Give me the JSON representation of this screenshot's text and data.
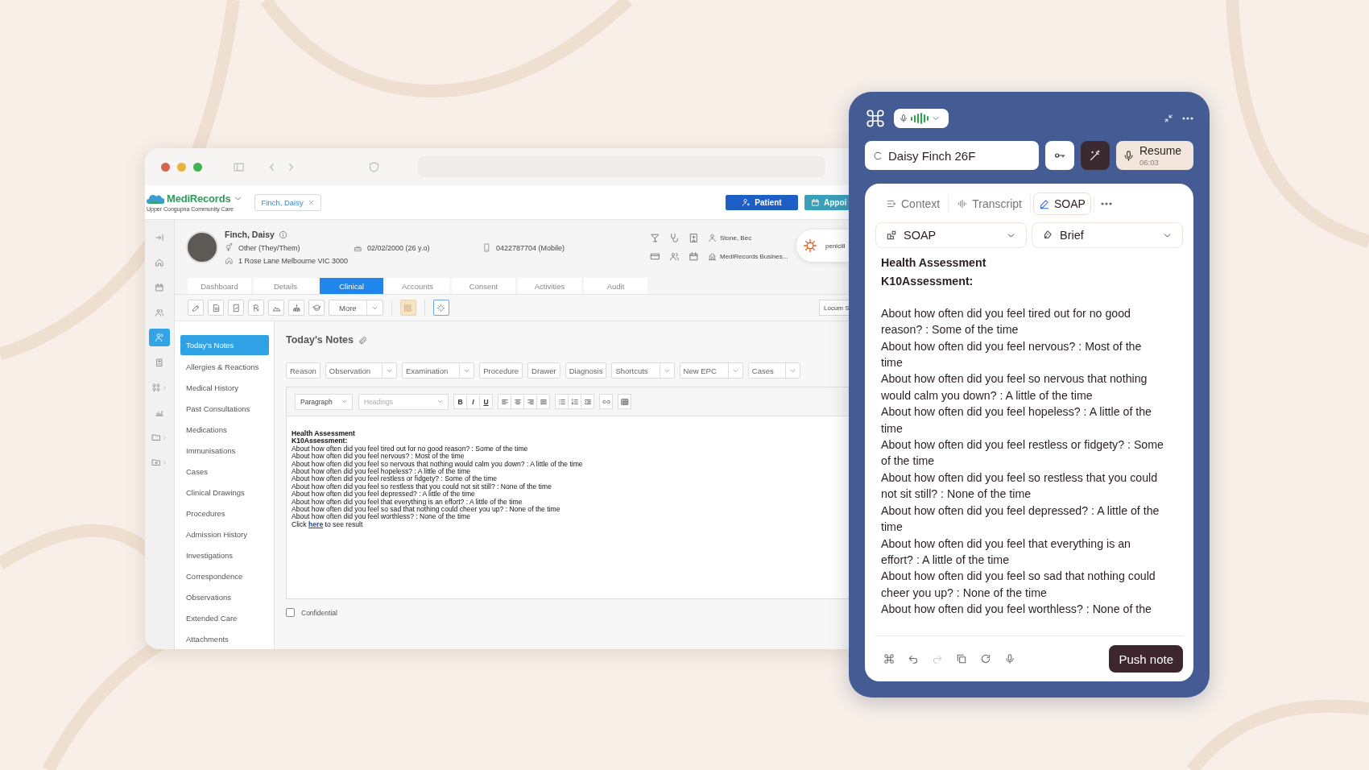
{
  "left_window": {
    "app": {
      "name": "MediRecords",
      "subtitle": "Upper Congupna Community Care"
    },
    "patient_chip": "Finch, Daisy",
    "header_buttons": [
      {
        "label": "Patient",
        "kind": "primary"
      },
      {
        "label": "Appoi",
        "kind": "secondary"
      }
    ],
    "rail": [
      {
        "kind": "collapse",
        "selected": false,
        "submenu": false
      },
      {
        "kind": "home",
        "selected": false,
        "submenu": false
      },
      {
        "kind": "calendar",
        "selected": false,
        "submenu": false
      },
      {
        "kind": "people",
        "selected": false,
        "submenu": false
      },
      {
        "kind": "patient",
        "selected": true,
        "submenu": false
      },
      {
        "kind": "clipboard",
        "selected": false,
        "submenu": false
      },
      {
        "kind": "apps",
        "selected": false,
        "submenu": true
      },
      {
        "kind": "chart",
        "selected": false,
        "submenu": false
      },
      {
        "kind": "folder",
        "selected": false,
        "submenu": true
      },
      {
        "kind": "folder-add",
        "selected": false,
        "submenu": true
      }
    ],
    "patient": {
      "name": "Finch, Daisy",
      "gender": "Other (They/Them)",
      "dob": "02/02/2000 (26 y.o)",
      "phone": "0422787704 (Mobile)",
      "address": "1 Rose Lane Melbourne VIC 3000",
      "practitioner": "Stone, Bec",
      "billing": "MediRecords Busines...",
      "allergy": "penicill"
    },
    "tabs": [
      {
        "label": "Dashboard",
        "selected": false
      },
      {
        "label": "Details",
        "selected": false
      },
      {
        "label": "Clinical",
        "selected": true
      },
      {
        "label": "Accounts",
        "selected": false
      },
      {
        "label": "Consent",
        "selected": false
      },
      {
        "label": "Activities",
        "selected": false
      },
      {
        "label": "Audit",
        "selected": false
      }
    ],
    "toolbar": {
      "more": "More",
      "right_field": "Locum S"
    },
    "nav": [
      {
        "label": "Today's Notes",
        "selected": true
      },
      {
        "label": "Allergies & Reactions",
        "selected": false
      },
      {
        "label": "Medical History",
        "selected": false
      },
      {
        "label": "Past Consultations",
        "selected": false
      },
      {
        "label": "Medications",
        "selected": false
      },
      {
        "label": "Immunisations",
        "selected": false
      },
      {
        "label": "Cases",
        "selected": false
      },
      {
        "label": "Clinical Drawings",
        "selected": false
      },
      {
        "label": "Procedures",
        "selected": false
      },
      {
        "label": "Admission History",
        "selected": false
      },
      {
        "label": "Investigations",
        "selected": false
      },
      {
        "label": "Correspondence",
        "selected": false
      },
      {
        "label": "Observations",
        "selected": false
      },
      {
        "label": "Extended Care",
        "selected": false
      },
      {
        "label": "Attachments",
        "selected": false
      }
    ],
    "notes": {
      "title": "Today's Notes",
      "chips": [
        {
          "label": "Reason",
          "dropdown": false
        },
        {
          "label": "Observation",
          "dropdown": true
        },
        {
          "label": "Examination",
          "dropdown": true
        },
        {
          "label": "Procedure",
          "dropdown": false
        },
        {
          "label": "Drawer",
          "dropdown": false
        },
        {
          "label": "Diagnosis",
          "dropdown": false
        },
        {
          "label": "Shortcuts",
          "dropdown": true
        },
        {
          "label": "New EPC",
          "dropdown": true
        },
        {
          "label": "Cases",
          "dropdown": true
        }
      ],
      "paragraph_select": "Paragraph",
      "headings_placeholder": "Headings",
      "format_buttons": [
        "B",
        "I",
        "U"
      ],
      "headings": [
        "Health Assessment",
        "K10Assessment:"
      ],
      "lines": [
        "About how often did you feel tired out for no good reason? : Some of the time",
        "About how often did you feel nervous? : Most of the time",
        "About how often did you feel so nervous that nothing would calm you down? : A little of the time",
        "About how often did you feel hopeless? : A little of the time",
        "About how often did you feel restless or fidgety? : Some of the time",
        "About how often did you feel so restless that you could not sit still? : None of the time",
        "About how often did you feel depressed? : A little of the time",
        "About how often did you feel that everything is an effort? : A little of the time",
        "About how often did you feel so sad that nothing could cheer you up? : None of the time",
        "About how often did you feel worthless? : None of the time"
      ],
      "result_line": {
        "before": "Click",
        "link": "here",
        "after": "to see result"
      },
      "confidential": {
        "label": "Confidential",
        "checked": false
      }
    }
  },
  "scribe_panel": {
    "patient_field": "Daisy Finch 26F",
    "resume": {
      "label": "Resume",
      "time": "06:03"
    },
    "tabs": [
      {
        "kind": "context",
        "label": "Context",
        "selected": false
      },
      {
        "kind": "transcript",
        "label": "Transcript",
        "selected": false
      },
      {
        "kind": "soap",
        "label": "SOAP",
        "selected": true
      }
    ],
    "dropdowns": [
      {
        "kind": "template",
        "label": "SOAP"
      },
      {
        "kind": "style",
        "label": "Brief"
      }
    ],
    "note": {
      "headings": [
        "Health Assessment",
        "K10Assessment:"
      ],
      "lines": [
        "About how often did you feel tired out for no good reason? : Some of the time",
        "About how often did you feel nervous? : Most of the time",
        "About how often did you feel so nervous that nothing would calm you down? : A little of the time",
        "About how often did you feel hopeless? : A little of the time",
        "About how often did you feel restless or fidgety? : Some of the time",
        "About how often did you feel so restless that you could not sit still? : None of the time",
        "About how often did you feel depressed? : A little of the time",
        "About how often did you feel that everything is an effort? : A little of the time",
        "About how often did you feel so sad that nothing could cheer you up? : None of the time",
        "About how often did you feel worthless? : None of the"
      ]
    },
    "actions": [
      {
        "kind": "logo",
        "disabled": false
      },
      {
        "kind": "undo",
        "disabled": false
      },
      {
        "kind": "redo",
        "disabled": true
      },
      {
        "kind": "copy",
        "disabled": false
      },
      {
        "kind": "refresh",
        "disabled": false
      },
      {
        "kind": "mic",
        "disabled": false
      }
    ],
    "push_button": "Push note"
  }
}
